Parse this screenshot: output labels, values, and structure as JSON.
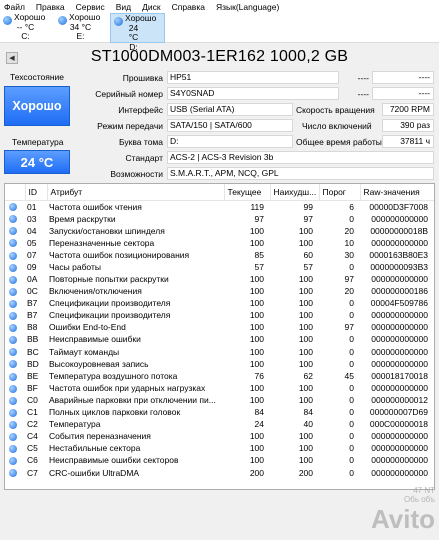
{
  "menu": [
    "Файл",
    "Правка",
    "Сервис",
    "Вид",
    "Диск",
    "Справка",
    "Язык(Language)"
  ],
  "drives": [
    {
      "status": "Хорошо",
      "temp": "-- °C",
      "letter": "C:"
    },
    {
      "status": "Хорошо",
      "temp": "34 °C",
      "letter": "E:"
    },
    {
      "status": "Хорошо",
      "temp": "24 °C",
      "letter": "D:"
    }
  ],
  "title": "ST1000DM003-1ER162 1000,2 GB",
  "nav_prev": "◀",
  "status_label": "Техсостояние",
  "health": "Хорошо",
  "temp_label": "Температура",
  "temperature": "24 °C",
  "info_left": [
    {
      "label": "Прошивка",
      "value": "HP51"
    },
    {
      "label": "Серийный номер",
      "value": "S4Y0SNAD"
    },
    {
      "label": "Интерфейс",
      "value": "USB (Serial ATA)"
    },
    {
      "label": "Режим передачи",
      "value": "SATA/150 | SATA/600"
    },
    {
      "label": "Буква тома",
      "value": "D:"
    }
  ],
  "info_right": [
    {
      "label": "",
      "value": "----",
      "value2": "----"
    },
    {
      "label": "",
      "value": "----",
      "value2": "----"
    },
    {
      "label": "Скорость вращения",
      "value": "7200 RPM"
    },
    {
      "label": "Число включений",
      "value": "390 раз"
    },
    {
      "label": "Общее время работы",
      "value": "37811 ч"
    }
  ],
  "standard": {
    "label": "Стандарт",
    "value": "ACS-2 | ACS-3 Revision 3b"
  },
  "features": {
    "label": "Возможности",
    "value": "S.M.A.R.T., APM, NCQ, GPL"
  },
  "table": {
    "headers": [
      "ID",
      "Атрибут",
      "Текущее",
      "Наихудш...",
      "Порог",
      "Raw-значения"
    ],
    "rows": [
      {
        "id": "01",
        "name": "Частота ошибок чтения",
        "cur": "119",
        "worst": "99",
        "thr": "6",
        "raw": "00000D3F7008"
      },
      {
        "id": "03",
        "name": "Время раскрутки",
        "cur": "97",
        "worst": "97",
        "thr": "0",
        "raw": "000000000000"
      },
      {
        "id": "04",
        "name": "Запуски/остановки шпинделя",
        "cur": "100",
        "worst": "100",
        "thr": "20",
        "raw": "00000000018B"
      },
      {
        "id": "05",
        "name": "Переназначенные сектора",
        "cur": "100",
        "worst": "100",
        "thr": "10",
        "raw": "000000000000"
      },
      {
        "id": "07",
        "name": "Частота ошибок позиционирования",
        "cur": "85",
        "worst": "60",
        "thr": "30",
        "raw": "0000163B80E3"
      },
      {
        "id": "09",
        "name": "Часы работы",
        "cur": "57",
        "worst": "57",
        "thr": "0",
        "raw": "0000000093B3"
      },
      {
        "id": "0A",
        "name": "Повторные попытки раскрутки",
        "cur": "100",
        "worst": "100",
        "thr": "97",
        "raw": "000000000000"
      },
      {
        "id": "0C",
        "name": "Включения/отключения",
        "cur": "100",
        "worst": "100",
        "thr": "20",
        "raw": "000000000186"
      },
      {
        "id": "B7",
        "name": "Спецификации производителя",
        "cur": "100",
        "worst": "100",
        "thr": "0",
        "raw": "00004F509786"
      },
      {
        "id": "B7",
        "name": "Спецификации производителя",
        "cur": "100",
        "worst": "100",
        "thr": "0",
        "raw": "000000000000"
      },
      {
        "id": "B8",
        "name": "Ошибки End-to-End",
        "cur": "100",
        "worst": "100",
        "thr": "97",
        "raw": "000000000000"
      },
      {
        "id": "BB",
        "name": "Неисправимые ошибки",
        "cur": "100",
        "worst": "100",
        "thr": "0",
        "raw": "000000000000"
      },
      {
        "id": "BC",
        "name": "Таймаут команды",
        "cur": "100",
        "worst": "100",
        "thr": "0",
        "raw": "000000000000"
      },
      {
        "id": "BD",
        "name": "Высокоуровневая запись",
        "cur": "100",
        "worst": "100",
        "thr": "0",
        "raw": "000000000000"
      },
      {
        "id": "BE",
        "name": "Температура воздушного потока",
        "cur": "76",
        "worst": "62",
        "thr": "45",
        "raw": "000018170018"
      },
      {
        "id": "BF",
        "name": "Частота ошибок при ударных нагрузках",
        "cur": "100",
        "worst": "100",
        "thr": "0",
        "raw": "000000000000"
      },
      {
        "id": "C0",
        "name": "Аварийные парковки при отключении пи...",
        "cur": "100",
        "worst": "100",
        "thr": "0",
        "raw": "000000000012"
      },
      {
        "id": "C1",
        "name": "Полных циклов парковки головок",
        "cur": "84",
        "worst": "84",
        "thr": "0",
        "raw": "000000007D69"
      },
      {
        "id": "C2",
        "name": "Температура",
        "cur": "24",
        "worst": "40",
        "thr": "0",
        "raw": "000C00000018"
      },
      {
        "id": "C4",
        "name": "События переназначения",
        "cur": "100",
        "worst": "100",
        "thr": "0",
        "raw": "000000000000"
      },
      {
        "id": "C5",
        "name": "Нестабильные сектора",
        "cur": "100",
        "worst": "100",
        "thr": "0",
        "raw": "000000000000"
      },
      {
        "id": "C6",
        "name": "Неисправимые ошибки секторов",
        "cur": "100",
        "worst": "100",
        "thr": "0",
        "raw": "000000000000"
      },
      {
        "id": "C7",
        "name": "CRC-ошибки UltraDMA",
        "cur": "200",
        "worst": "200",
        "thr": "0",
        "raw": "000000000000"
      }
    ]
  },
  "selected_row": 17,
  "watermark": {
    "top": "47 NT",
    "sub": "Обь объ",
    "brand": "Avito"
  }
}
